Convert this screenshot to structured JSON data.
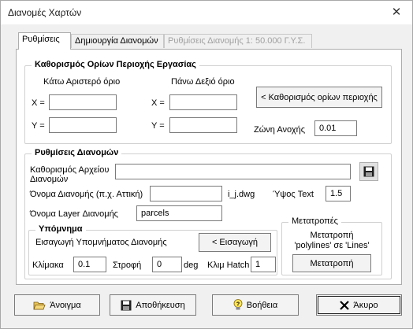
{
  "window": {
    "title": "Διανομές Χαρτών",
    "close_glyph": "✕"
  },
  "tabs": [
    {
      "label": "Ρυθμίσεις",
      "active": true
    },
    {
      "label": "Δημιουργία Διανομών"
    },
    {
      "label": "Ρυθμίσεις Διανομής 1: 50.000 Γ.Υ.Σ.",
      "disabled": true
    }
  ],
  "area_bounds": {
    "title": "Καθορισμός Ορίων Περιοχής Εργασίας",
    "lower_left_label": "Κάτω Αριστερό όριο",
    "upper_right_label": "Πάνω Δεξιό όριο",
    "x_label": "X =",
    "y_label": "Y =",
    "x_left_value": "",
    "y_left_value": "",
    "x_right_value": "",
    "y_right_value": "",
    "define_button": "< Καθορισμός ορίων περιοχής",
    "tolerance_label": "Ζώνη Ανοχής",
    "tolerance_value": "0.01"
  },
  "sheet_settings": {
    "title": "Ρυθμίσεις Διανομών",
    "file_label_line1": "Καθορισμός Αρχείου",
    "file_label_line2": "Διανομών",
    "file_value": "",
    "sheet_name_label": "Όνομα Διανομής (π.χ. Αττική)",
    "sheet_name_value": "",
    "sheet_suffix": "i_j.dwg",
    "text_height_label": "Ύψος Text",
    "text_height_value": "1.5",
    "layer_label": "Όνομα Layer Διανομής",
    "layer_value": "parcels"
  },
  "legend": {
    "title": "Υπόμνημα",
    "insert_label": "Εισαγωγή Υπομνήματος Διανομής",
    "insert_button": "< Εισαγωγή",
    "scale_label": "Κλίμακα",
    "scale_value": "0.1",
    "rotation_label": "Στροφή",
    "rotation_value": "0",
    "rotation_unit": "deg",
    "hatch_label": "Κλιμ Hatch",
    "hatch_value": "1"
  },
  "conversions": {
    "title": "Μετατροπές",
    "desc_line1": "Μετατροπή",
    "desc_line2": "'polylines' σε 'Lines'",
    "button": "Μετατροπή"
  },
  "footer": {
    "open": "Άνοιγμα",
    "save": "Αποθήκευση",
    "help": "Βοήθεια",
    "cancel": "Άκυρο"
  }
}
